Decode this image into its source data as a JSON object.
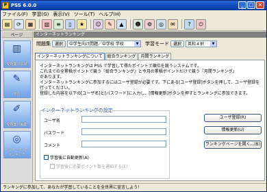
{
  "window": {
    "title": "PSS 6.0.0"
  },
  "menu": [
    "ファイル(F)",
    "学習(G)",
    "表示(V)",
    "ツール(T)",
    "ヘルプ(H)"
  ],
  "sidebar": {
    "header": "ページ",
    "items": [
      {
        "label": "問題集の情報",
        "icon": "book-icon"
      },
      {
        "label": "学習",
        "icon": "study-icon"
      },
      {
        "label": "問題集の編集",
        "icon": "edit-icon"
      },
      {
        "label": "インターネットランキング",
        "icon": "network-icon"
      }
    ]
  },
  "main": {
    "header": "インターネットランキング",
    "problem_set_label": "問題集",
    "select_button": "選択",
    "problem_set_value": "中学生向け問題／中学校 学校",
    "study_mode_label": "学習モード",
    "study_mode_select_button": "選択",
    "study_mode_value": "英和４択",
    "tabs": [
      "インターネットランキングについて",
      "総合ランキング",
      "月間ランキング"
    ],
    "description": [
      "インターネットランキングは PSS で学習して得たポイントで順位を競うシステムです。",
      "これまでの全累積ポイントで競う『総合ランキング』と今月の累積ポイントだけで競う『月間ランキング』",
      "があります。",
      "インターネットランキングに参加するにはユーザ登録が必要です。下にある[ユーザ登録]ボタンを押して、ユーザ登録を行ってください。",
      "登録した内容を以下の[ユーザ名]と[パスワード]に入力し、[情報更新]ボタンを押すとランキングに参加できます。"
    ],
    "settings_title": "インターネットランキングの設定",
    "fields": {
      "username_label": "ユーザ名",
      "password_label": "パスワード",
      "comment_label": "コメント",
      "username_value": "",
      "password_value": "",
      "comment_value": ""
    },
    "auto_update_label": "学習後に自動更新(A)",
    "notify_label": "学習後に必要ポイント数を通知する(E)",
    "buttons": {
      "register": "ユーザ登録(R)",
      "update": "情報更新(U)",
      "open_page": "ランキングページを開く...(B)"
    }
  },
  "status": "ランキングに参加して、あなたが学習していることを全世界に宣言しよう！"
}
